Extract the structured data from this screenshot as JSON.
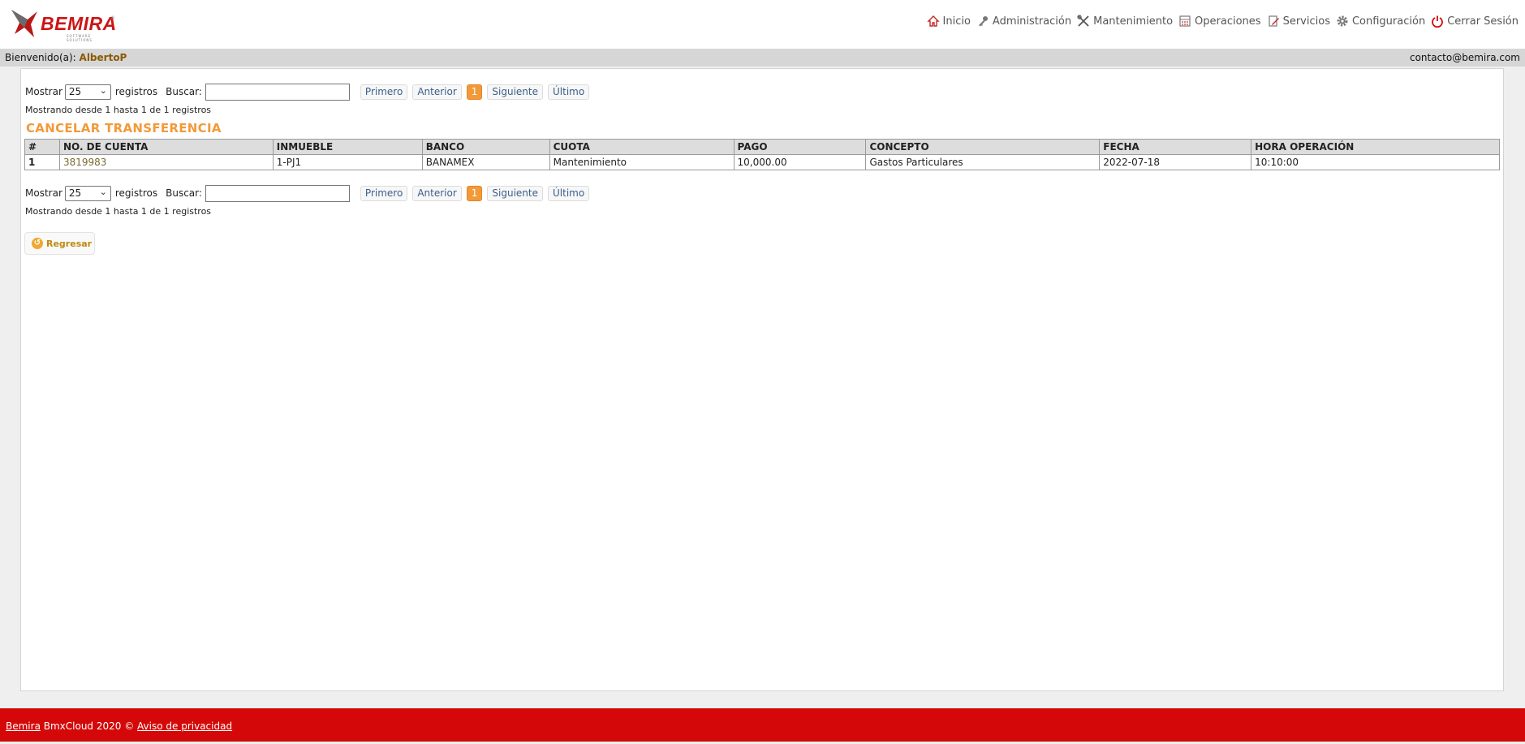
{
  "brand": {
    "logo_text": "BEMIRA",
    "logo_sub": "SOFTWARE SOLUTIONS",
    "logo_reg": "®"
  },
  "nav": {
    "items": [
      {
        "label": "Inicio",
        "icon": "home-icon"
      },
      {
        "label": "Administración",
        "icon": "key-icon"
      },
      {
        "label": "Mantenimiento",
        "icon": "tools-icon"
      },
      {
        "label": "Operaciones",
        "icon": "calculator-icon"
      },
      {
        "label": "Servicios",
        "icon": "document-pencil-icon"
      },
      {
        "label": "Configuración",
        "icon": "gear-icon"
      },
      {
        "label": "Cerrar Sesión",
        "icon": "power-icon"
      }
    ]
  },
  "welcome": {
    "label": "Bienvenido(a):",
    "user": "AlbertoP",
    "email": "contacto@bemira.com"
  },
  "controls": {
    "show_label": "Mostrar",
    "show_value": "25",
    "records_label": "registros",
    "search_label": "Buscar:",
    "search_value": "",
    "pager": {
      "first": "Primero",
      "prev": "Anterior",
      "current": "1",
      "next": "Siguiente",
      "last": "Último"
    },
    "info": "Mostrando desde 1 hasta 1 de 1 registros"
  },
  "page_title": "CANCELAR TRANSFERENCIA",
  "table": {
    "headers": [
      "#",
      "NO. DE CUENTA",
      "INMUEBLE",
      "BANCO",
      "CUOTA",
      "PAGO",
      "CONCEPTO",
      "FECHA",
      "HORA OPERACIÓN"
    ],
    "rows": [
      [
        "1",
        "3819983",
        "1-PJ1",
        "BANAMEX",
        "Mantenimiento",
        "10,000.00",
        "Gastos Particulares",
        "2022-07-18",
        "10:10:00"
      ]
    ]
  },
  "back_button": "Regresar",
  "footer": {
    "brand_link": "Bemira",
    "text": " BmxCloud 2020 © ",
    "privacy_link": "Aviso de privacidad"
  },
  "colors": {
    "accent": "#f29a38",
    "footer_red": "#d40808",
    "brand_red": "#cc1515"
  }
}
